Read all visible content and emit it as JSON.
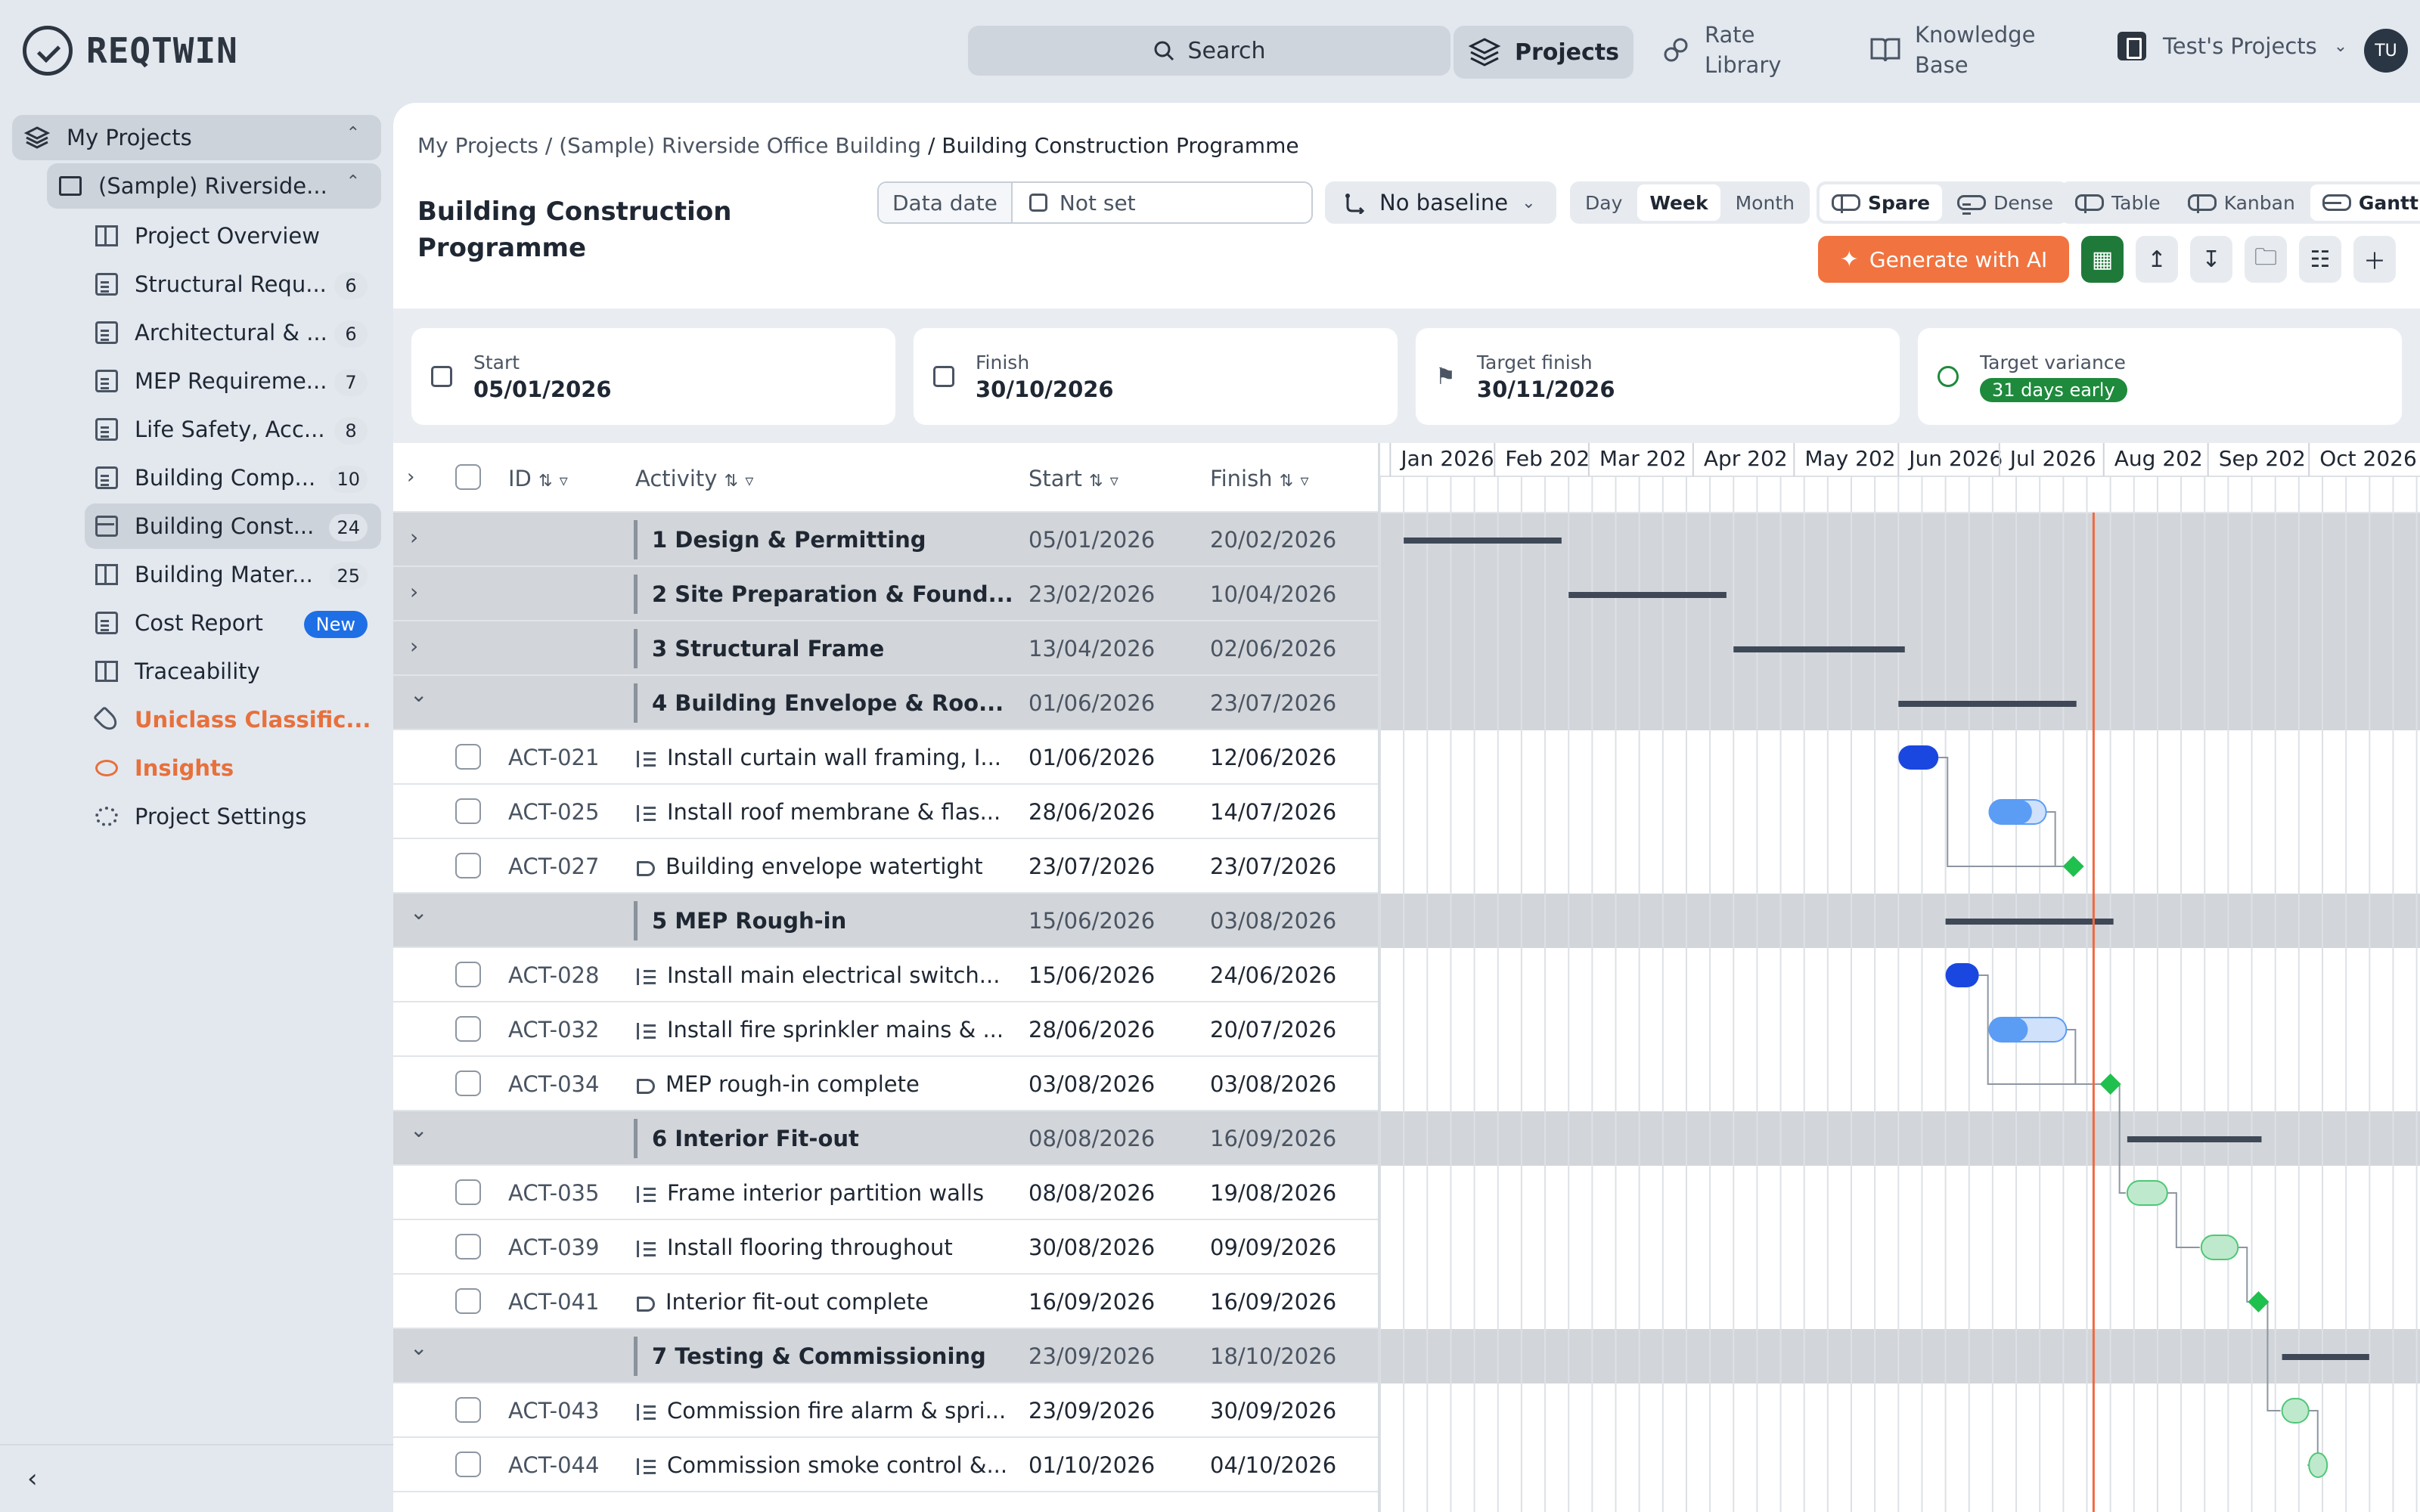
{
  "app": {
    "name": "REQTWIN",
    "search": "Search",
    "projects": "Projects",
    "rate_library": [
      "Rate",
      "Library"
    ],
    "knowledge_base": [
      "Knowledge",
      "Base"
    ],
    "workspace": "Test's Projects",
    "avatar": "TU"
  },
  "sidebar": {
    "my_projects": "My Projects",
    "project": "(Sample) Riverside...",
    "items": [
      {
        "label": "Project Overview",
        "badge": "",
        "icon": "grid-icon"
      },
      {
        "label": "Structural Requ...",
        "badge": "6",
        "icon": "document-icon"
      },
      {
        "label": "Architectural & ...",
        "badge": "6",
        "icon": "document-icon"
      },
      {
        "label": "MEP Requireme...",
        "badge": "7",
        "icon": "document-icon"
      },
      {
        "label": "Life Safety, Acc...",
        "badge": "8",
        "icon": "document-icon"
      },
      {
        "label": "Building Comp...",
        "badge": "10",
        "icon": "clipboard-icon"
      },
      {
        "label": "Building Const...",
        "badge": "24",
        "icon": "calendar-icon"
      },
      {
        "label": "Building Mater...",
        "badge": "25",
        "icon": "cube-icon"
      },
      {
        "label": "Cost Report",
        "badge": "New",
        "icon": "dollar-icon"
      },
      {
        "label": "Traceability",
        "badge": "",
        "icon": "table-icon"
      },
      {
        "label": "Uniclass Classific...",
        "badge": "",
        "icon": "tag-icon"
      },
      {
        "label": "Insights",
        "badge": "",
        "icon": "bulb-icon"
      },
      {
        "label": "Project Settings",
        "badge": "",
        "icon": "gear-icon"
      }
    ]
  },
  "header": {
    "breadcrumb": [
      "My Projects",
      "/ (Sample) Riverside Office Building",
      "/ Building Construction Programme"
    ],
    "title": "Building Construction Programme",
    "data_date_label": "Data date",
    "data_date_value": "Not set",
    "baseline": "No baseline",
    "scale": [
      "Day",
      "Week",
      "Month"
    ],
    "density": [
      "Spare",
      "Dense"
    ],
    "views": [
      "Table",
      "Kanban",
      "Gantt"
    ],
    "generate": "Generate with AI"
  },
  "stats": [
    {
      "label": "Start",
      "value": "05/01/2026"
    },
    {
      "label": "Finish",
      "value": "30/10/2026"
    },
    {
      "label": "Target finish",
      "value": "30/11/2026"
    },
    {
      "label": "Target variance",
      "value": "31 days early"
    }
  ],
  "table": {
    "headers": {
      "id": "ID",
      "activity": "Activity",
      "start": "Start",
      "finish": "Finish"
    },
    "rows": [
      {
        "type": "group",
        "name": "1 Design & Permitting",
        "start": "05/01/2026",
        "finish": "20/02/2026",
        "expanded": false
      },
      {
        "type": "group",
        "name": "2 Site Preparation & Found...",
        "start": "23/02/2026",
        "finish": "10/04/2026",
        "expanded": false
      },
      {
        "type": "group",
        "name": "3 Structural Frame",
        "start": "13/04/2026",
        "finish": "02/06/2026",
        "expanded": false
      },
      {
        "type": "group",
        "name": "4 Building Envelope & Roo...",
        "start": "01/06/2026",
        "finish": "23/07/2026",
        "expanded": true
      },
      {
        "type": "task",
        "id": "ACT-021",
        "name": "Install curtain wall framing, I...",
        "start": "01/06/2026",
        "finish": "12/06/2026"
      },
      {
        "type": "task",
        "id": "ACT-025",
        "name": "Install roof membrane & flas...",
        "start": "28/06/2026",
        "finish": "14/07/2026"
      },
      {
        "type": "milestone",
        "id": "ACT-027",
        "name": "Building envelope watertight",
        "start": "23/07/2026",
        "finish": "23/07/2026"
      },
      {
        "type": "group",
        "name": "5 MEP Rough-in",
        "start": "15/06/2026",
        "finish": "03/08/2026",
        "expanded": true
      },
      {
        "type": "task",
        "id": "ACT-028",
        "name": "Install main electrical switch...",
        "start": "15/06/2026",
        "finish": "24/06/2026"
      },
      {
        "type": "task",
        "id": "ACT-032",
        "name": "Install fire sprinkler mains & ...",
        "start": "28/06/2026",
        "finish": "20/07/2026"
      },
      {
        "type": "milestone",
        "id": "ACT-034",
        "name": "MEP rough-in complete",
        "start": "03/08/2026",
        "finish": "03/08/2026"
      },
      {
        "type": "group",
        "name": "6 Interior Fit-out",
        "start": "08/08/2026",
        "finish": "16/09/2026",
        "expanded": true
      },
      {
        "type": "task",
        "id": "ACT-035",
        "name": "Frame interior partition walls",
        "start": "08/08/2026",
        "finish": "19/08/2026"
      },
      {
        "type": "task",
        "id": "ACT-039",
        "name": "Install flooring throughout",
        "start": "30/08/2026",
        "finish": "09/09/2026"
      },
      {
        "type": "milestone",
        "id": "ACT-041",
        "name": "Interior fit-out complete",
        "start": "16/09/2026",
        "finish": "16/09/2026"
      },
      {
        "type": "group",
        "name": "7 Testing & Commissioning",
        "start": "23/09/2026",
        "finish": "18/10/2026",
        "expanded": true
      },
      {
        "type": "task",
        "id": "ACT-043",
        "name": "Commission fire alarm & spri...",
        "start": "23/09/2026",
        "finish": "30/09/2026"
      },
      {
        "type": "task",
        "id": "ACT-044",
        "name": "Commission smoke control &...",
        "start": "01/10/2026",
        "finish": "04/10/2026"
      }
    ]
  },
  "gantt": {
    "months": [
      "Jan 2026",
      "Feb 202",
      "Mar 202",
      "Apr 202",
      "May 202",
      "Jun 2026",
      "Jul 2026",
      "Aug 202",
      "Sep 202",
      "Oct 2026"
    ],
    "today": "29/07/2026",
    "colors": {
      "group_bar": "#3e4856",
      "task_done": "#1a47e0",
      "task_progress": "#5b9cf5",
      "task_future": "#bfe9cc",
      "milestone": "#20c04e",
      "today_line": "#f06a43"
    },
    "bars": [
      {
        "row": 0,
        "start": "05/01/2026",
        "finish": "20/02/2026",
        "kind": "group"
      },
      {
        "row": 1,
        "start": "23/02/2026",
        "finish": "10/04/2026",
        "kind": "group"
      },
      {
        "row": 2,
        "start": "13/04/2026",
        "finish": "02/06/2026",
        "kind": "group"
      },
      {
        "row": 3,
        "start": "01/06/2026",
        "finish": "23/07/2026",
        "kind": "group"
      },
      {
        "row": 4,
        "start": "01/06/2026",
        "finish": "12/06/2026",
        "kind": "done"
      },
      {
        "row": 5,
        "start": "28/06/2026",
        "finish": "14/07/2026",
        "kind": "progress",
        "progress": 0.75
      },
      {
        "row": 6,
        "start": "23/07/2026",
        "finish": "23/07/2026",
        "kind": "milestone"
      },
      {
        "row": 7,
        "start": "15/06/2026",
        "finish": "03/08/2026",
        "kind": "group"
      },
      {
        "row": 8,
        "start": "15/06/2026",
        "finish": "24/06/2026",
        "kind": "done"
      },
      {
        "row": 9,
        "start": "28/06/2026",
        "finish": "20/07/2026",
        "kind": "progress",
        "progress": 0.5
      },
      {
        "row": 10,
        "start": "03/08/2026",
        "finish": "03/08/2026",
        "kind": "milestone"
      },
      {
        "row": 11,
        "start": "08/08/2026",
        "finish": "16/09/2026",
        "kind": "group"
      },
      {
        "row": 12,
        "start": "08/08/2026",
        "finish": "19/08/2026",
        "kind": "future"
      },
      {
        "row": 13,
        "start": "30/08/2026",
        "finish": "09/09/2026",
        "kind": "future"
      },
      {
        "row": 14,
        "start": "16/09/2026",
        "finish": "16/09/2026",
        "kind": "milestone"
      },
      {
        "row": 15,
        "start": "23/09/2026",
        "finish": "18/10/2026",
        "kind": "group"
      },
      {
        "row": 16,
        "start": "23/09/2026",
        "finish": "30/09/2026",
        "kind": "future"
      },
      {
        "row": 17,
        "start": "01/10/2026",
        "finish": "04/10/2026",
        "kind": "future"
      }
    ],
    "links": [
      [
        4,
        6
      ],
      [
        5,
        6
      ],
      [
        8,
        10
      ],
      [
        9,
        10
      ],
      [
        10,
        12
      ],
      [
        12,
        13
      ],
      [
        13,
        14
      ],
      [
        14,
        16
      ],
      [
        16,
        17
      ]
    ]
  }
}
